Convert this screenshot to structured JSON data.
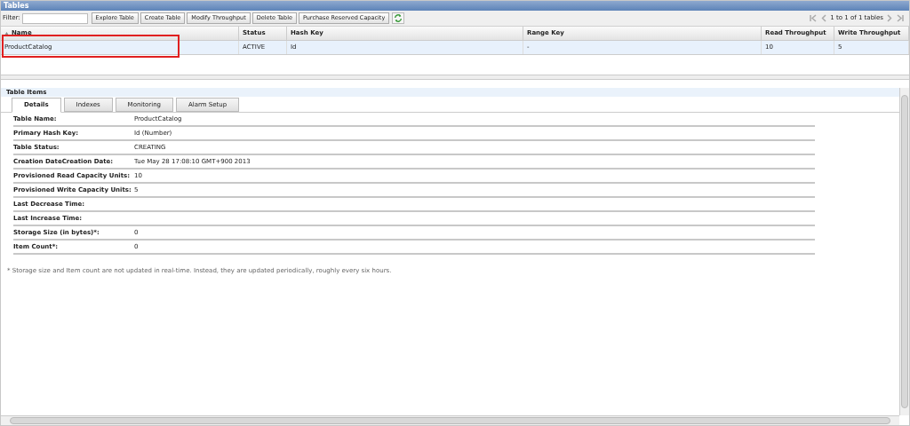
{
  "panel_title": "Tables",
  "toolbar": {
    "filter_label": "Filter:",
    "buttons": [
      "Explore Table",
      "Create Table",
      "Modify Throughput",
      "Delete Table",
      "Purchase Reserved Capacity"
    ],
    "pager": "1 to 1 of 1 tables"
  },
  "table": {
    "columns": [
      "Name",
      "Status",
      "Hash Key",
      "Range Key",
      "Read Throughput",
      "Write Throughput"
    ],
    "rows": [
      {
        "cells": [
          "ProductCatalog",
          "ACTIVE",
          "Id",
          "-",
          "10",
          "5"
        ],
        "selected": true,
        "highlighted": true
      }
    ]
  },
  "details_panel": {
    "title": "Table Items",
    "tabs": [
      {
        "label": "Details",
        "selected": true
      },
      {
        "label": "Indexes",
        "selected": false
      },
      {
        "label": "Monitoring",
        "selected": false
      },
      {
        "label": "Alarm Setup",
        "selected": false
      }
    ],
    "fields": [
      {
        "label": "Table Name:",
        "value": "ProductCatalog"
      },
      {
        "label": "Primary Hash Key:",
        "value": "Id (Number)"
      },
      {
        "label": "Table Status:",
        "value": "CREATING"
      },
      {
        "label": "Creation DateCreation Date:",
        "value": "Tue May 28 17:08:10 GMT+900 2013"
      },
      {
        "label": "Provisioned Read Capacity Units:",
        "value": "10"
      },
      {
        "label": "Provisioned Write Capacity Units:",
        "value": "5"
      },
      {
        "label": "Last Decrease Time:"
      },
      {
        "label": "Last Increase Time:"
      },
      {
        "label": "Storage Size (in bytes)*:",
        "value": "0"
      },
      {
        "label": "Item Count*:",
        "value": "0"
      }
    ],
    "footnote": "* Storage size and Item count are not updated in real-time. Instead, they are updated periodically, roughly every six hours."
  }
}
